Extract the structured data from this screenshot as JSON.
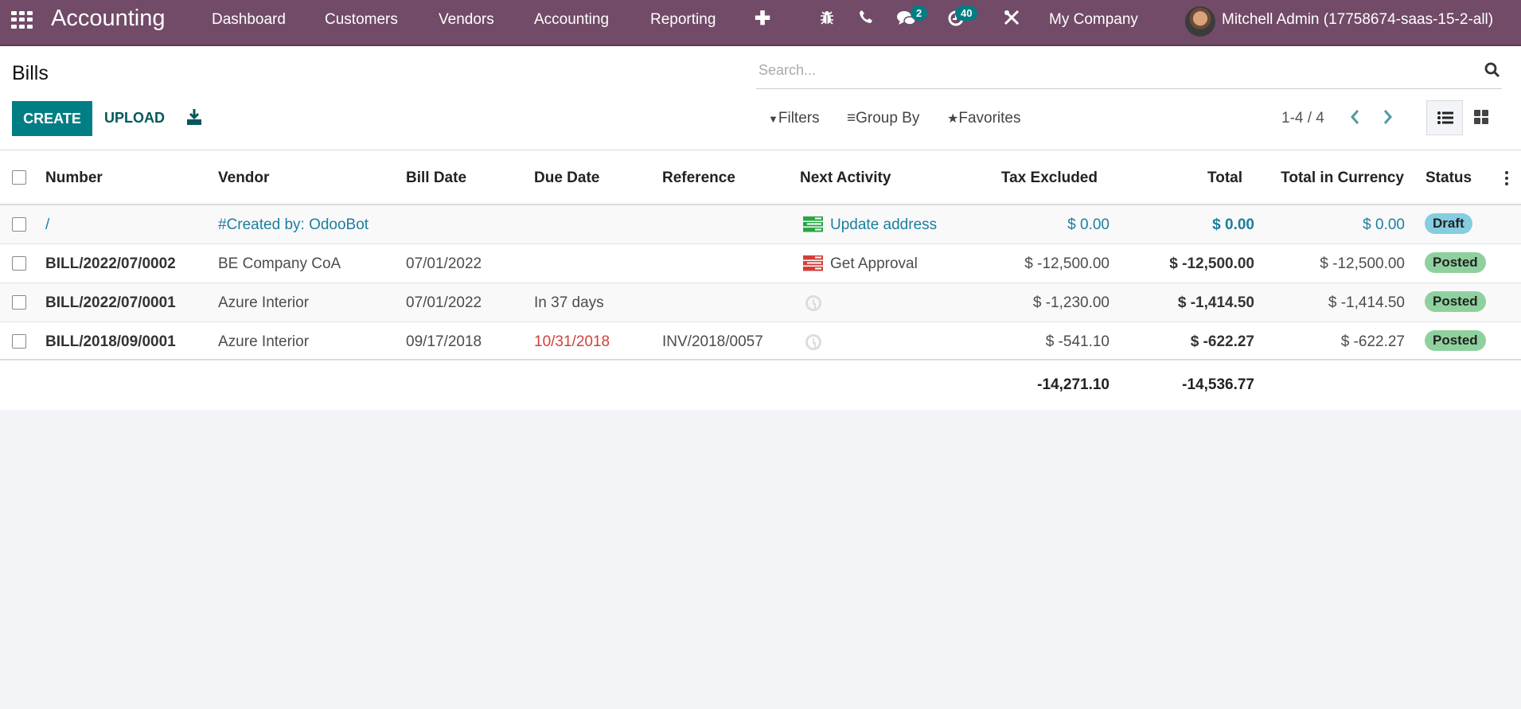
{
  "navbar": {
    "app_name": "Accounting",
    "menu": [
      "Dashboard",
      "Customers",
      "Vendors",
      "Accounting",
      "Reporting"
    ],
    "icons": [
      "apps-grid-icon",
      "plus-icon",
      "bug-icon",
      "phone-icon",
      "chat-icon",
      "activity-clock-icon",
      "tools-icon"
    ],
    "messages_count": "2",
    "activities_count": "40",
    "company": "My Company",
    "user": "Mitchell Admin (17758674-saas-15-2-all)"
  },
  "control_panel": {
    "title": "Bills",
    "create_label": "CREATE",
    "upload_label": "UPLOAD",
    "search_placeholder": "Search...",
    "filters_label": "Filters",
    "groupby_label": "Group By",
    "favorites_label": "Favorites",
    "pager": "1-4 / 4",
    "active_view": "list"
  },
  "table": {
    "columns": [
      "Number",
      "Vendor",
      "Bill Date",
      "Due Date",
      "Reference",
      "Next Activity",
      "Tax Excluded",
      "Total",
      "Total in Currency",
      "Status"
    ],
    "rows": [
      {
        "number": "/",
        "vendor": "#Created by: OdooBot",
        "bill_date": "",
        "due_date": "",
        "reference": "",
        "activity": "Update address",
        "activity_state": "planned",
        "tax_excluded": "$ 0.00",
        "total": "$ 0.00",
        "total_currency": "$ 0.00",
        "status": "Draft"
      },
      {
        "number": "BILL/2022/07/0002",
        "vendor": "BE Company CoA",
        "bill_date": "07/01/2022",
        "due_date": "",
        "reference": "",
        "activity": "Get Approval",
        "activity_state": "overdue",
        "tax_excluded": "$ -12,500.00",
        "total": "$ -12,500.00",
        "total_currency": "$ -12,500.00",
        "status": "Posted"
      },
      {
        "number": "BILL/2022/07/0001",
        "vendor": "Azure Interior",
        "bill_date": "07/01/2022",
        "due_date": "In 37 days",
        "reference": "",
        "activity": "",
        "activity_state": "none",
        "tax_excluded": "$ -1,230.00",
        "total": "$ -1,414.50",
        "total_currency": "$ -1,414.50",
        "status": "Posted"
      },
      {
        "number": "BILL/2018/09/0001",
        "vendor": "Azure Interior",
        "bill_date": "09/17/2018",
        "due_date": "10/31/2018",
        "reference": "INV/2018/0057",
        "activity": "",
        "activity_state": "none",
        "tax_excluded": "$ -541.10",
        "total": "$ -622.27",
        "total_currency": "$ -622.27",
        "status": "Posted"
      }
    ],
    "totals": {
      "tax_excluded": "-14,271.10",
      "total": "-14,536.77"
    }
  },
  "colors": {
    "navbar": "#714b67",
    "primary": "#017e84",
    "link": "#1a7fa0",
    "overdue_date": "#d23f3a",
    "draft_badge": "#85cde0",
    "posted_badge": "#8fd19e",
    "activity_planned": "#28a745",
    "activity_overdue": "#d23f3a"
  }
}
